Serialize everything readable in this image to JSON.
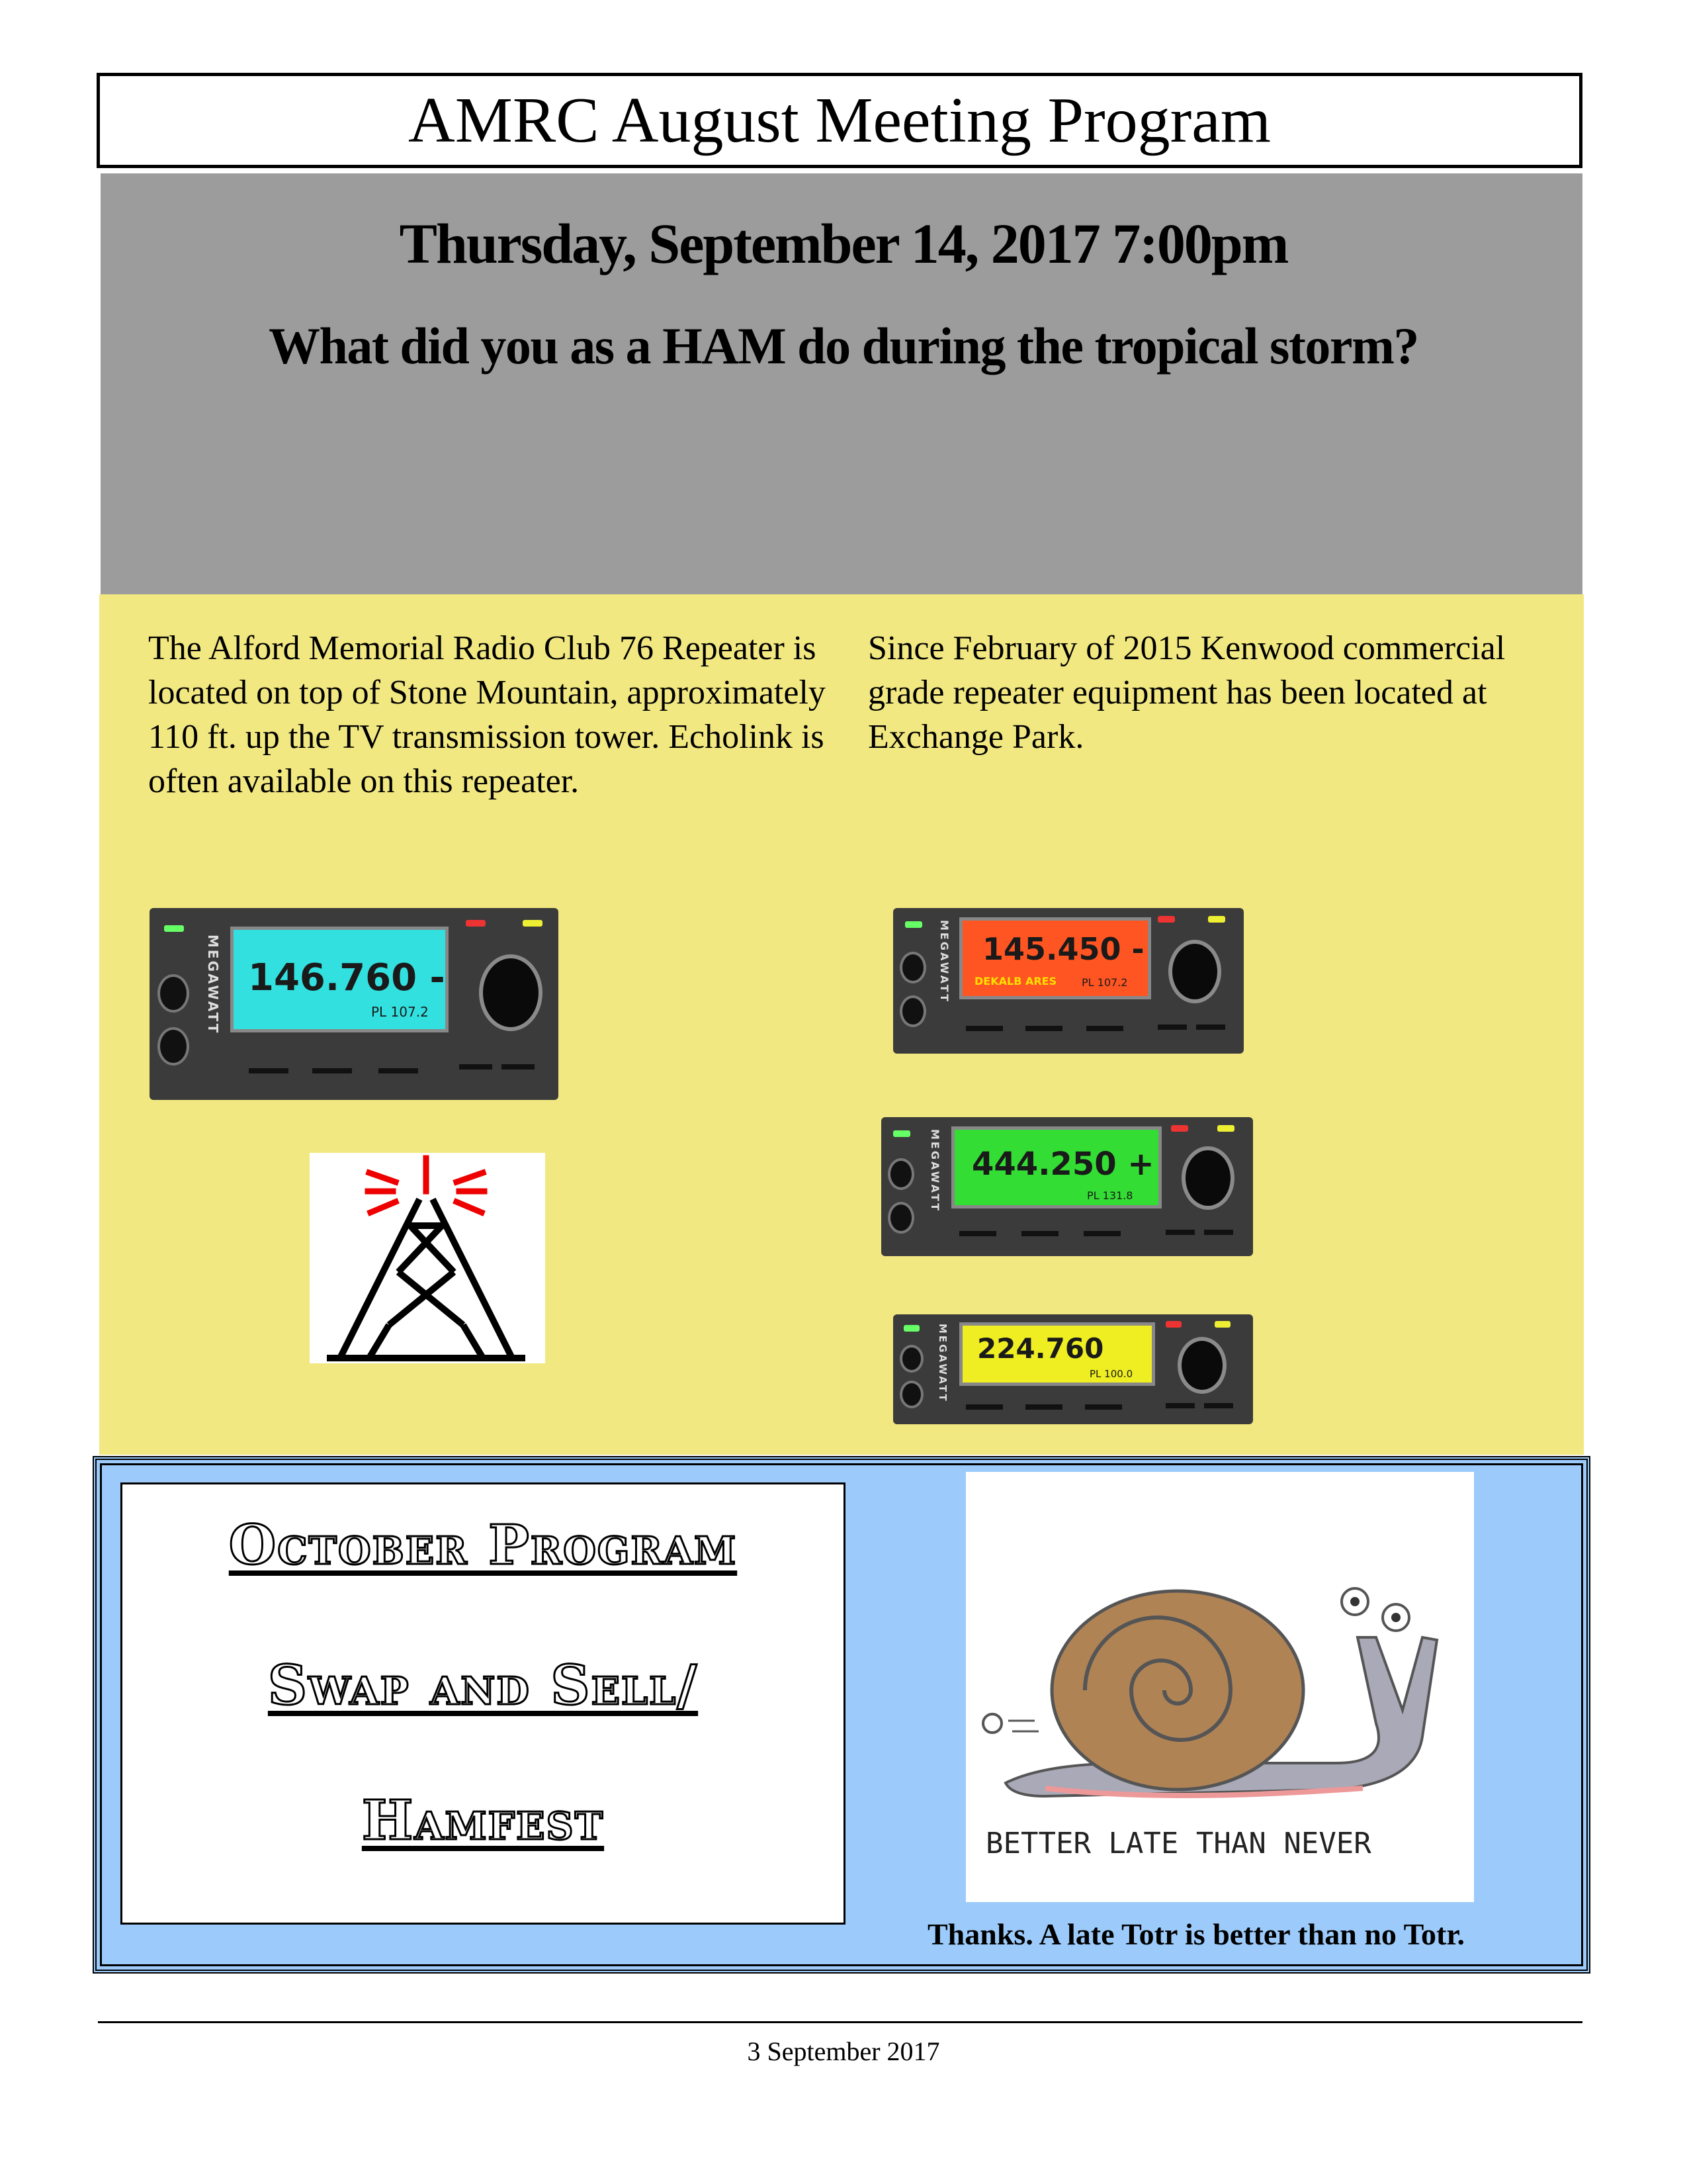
{
  "header": {
    "title": "AMRC August Meeting Program"
  },
  "meeting": {
    "date_time": "Thursday, September 14, 2017 7:00pm",
    "question": "What did you as a HAM do during the tropical storm?"
  },
  "repeater_info": {
    "left_paragraph": "The Alford Memorial Radio Club 76 Repeater is located on top of Stone Mountain, approximately 110 ft. up the TV transmission tower. Echolink is often available on this repeater.",
    "right_paragraph": "Since February of 2015 Kenwood commercial grade repeater equipment has been located at Exchange Park."
  },
  "radios": [
    {
      "brand": "MEGAWATT",
      "frequency": "146.760 -",
      "sub_label": "",
      "pl": "PL 107.2",
      "screen_color": "#33e0e0"
    },
    {
      "brand": "MEGAWATT",
      "frequency": "145.450 -",
      "sub_label": "DEKALB ARES",
      "pl": "PL 107.2",
      "screen_color": "#ff5522"
    },
    {
      "brand": "MEGAWATT",
      "frequency": "444.250 +",
      "sub_label": "",
      "pl": "PL 131.8",
      "screen_color": "#33dd33"
    },
    {
      "brand": "MEGAWATT",
      "frequency": "224.760",
      "sub_label": "",
      "pl": "PL 100.0",
      "screen_color": "#eeee22"
    }
  ],
  "october": {
    "line1": "October Program",
    "line2": "Swap and Sell/",
    "line3": "Hamfest"
  },
  "snail": {
    "caption": "BETTER LATE THAN NEVER"
  },
  "thanks": "Thanks.  A late Totr is better than no Totr.",
  "footer": {
    "date": "3 September 2017"
  }
}
